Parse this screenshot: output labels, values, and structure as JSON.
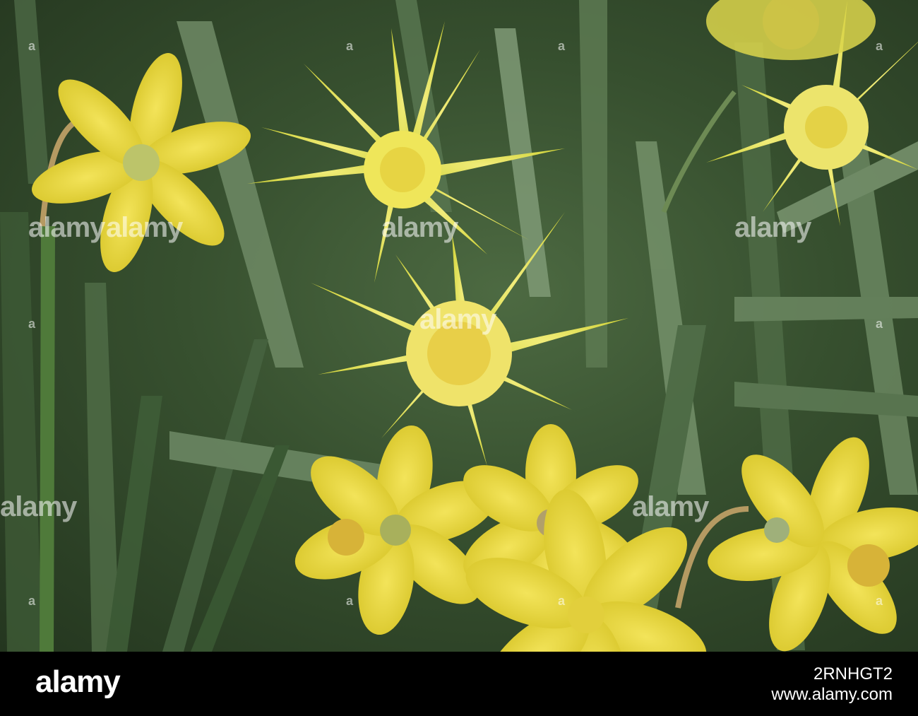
{
  "watermark": {
    "brand": "alamy",
    "tile_marker": "a"
  },
  "footer": {
    "logo": "alamy",
    "image_id": "2RNHGT2",
    "url": "www.alamy.com"
  },
  "colors": {
    "background_leaf_dark": "#24361f",
    "background_leaf_mid": "#4d6a42",
    "daffodil_yellow": "#e8d93a",
    "double_daffodil_yellow": "#e6e56a",
    "trumpet_orange": "#d7b338",
    "footer_bg": "#000000",
    "footer_text": "#ffffff"
  }
}
